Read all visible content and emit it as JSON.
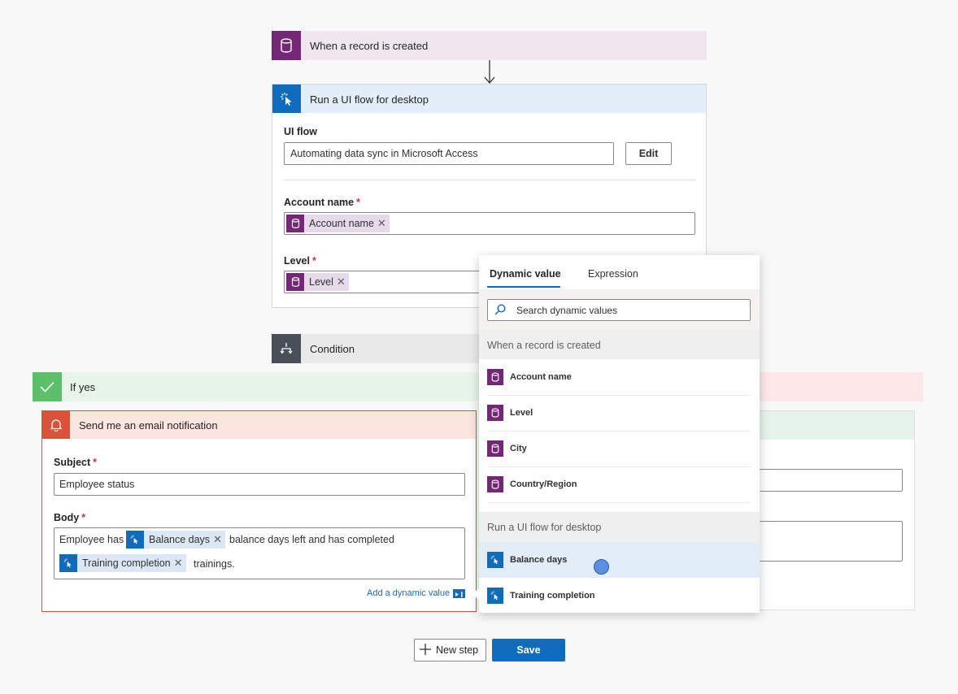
{
  "trigger": {
    "title": "When a record is created"
  },
  "ui_flow_card": {
    "title": "Run a UI flow for desktop",
    "ui_flow_label": "UI flow",
    "ui_flow_value": "Automating data sync in Microsoft Access",
    "edit_label": "Edit",
    "account_label": "Account name",
    "account_token": "Account name",
    "level_label": "Level",
    "level_token": "Level",
    "required_mark": "*"
  },
  "condition": {
    "title": "Condition"
  },
  "if_yes": {
    "title": "If yes"
  },
  "email_card": {
    "title": "Send me an email notification",
    "subject_label": "Subject",
    "subject_value": "Employee status",
    "body_label": "Body",
    "body_text_1": "Employee has",
    "token_balance": "Balance days",
    "body_text_2": "balance days left and has completed",
    "token_training": "Training completion",
    "body_text_3": "trainings.",
    "add_dynamic": "Add a dynamic value",
    "required_mark": "*"
  },
  "dynamic_panel": {
    "tabs": [
      "Dynamic value",
      "Expression"
    ],
    "search_placeholder": "Search dynamic values",
    "group1": "When a record is created",
    "group1_items": [
      "Account name",
      "Level",
      "City",
      "Country/Region"
    ],
    "group2": "Run a UI flow for desktop",
    "group2_items": [
      "Balance days",
      "Training completion"
    ]
  },
  "footer": {
    "new_step": "New step",
    "save": "Save"
  },
  "colors": {
    "accent": "#0f6cbd",
    "dataverse": "#742774",
    "success": "#5cbf6a",
    "email": "#d9533a",
    "condition": "#484f58"
  }
}
